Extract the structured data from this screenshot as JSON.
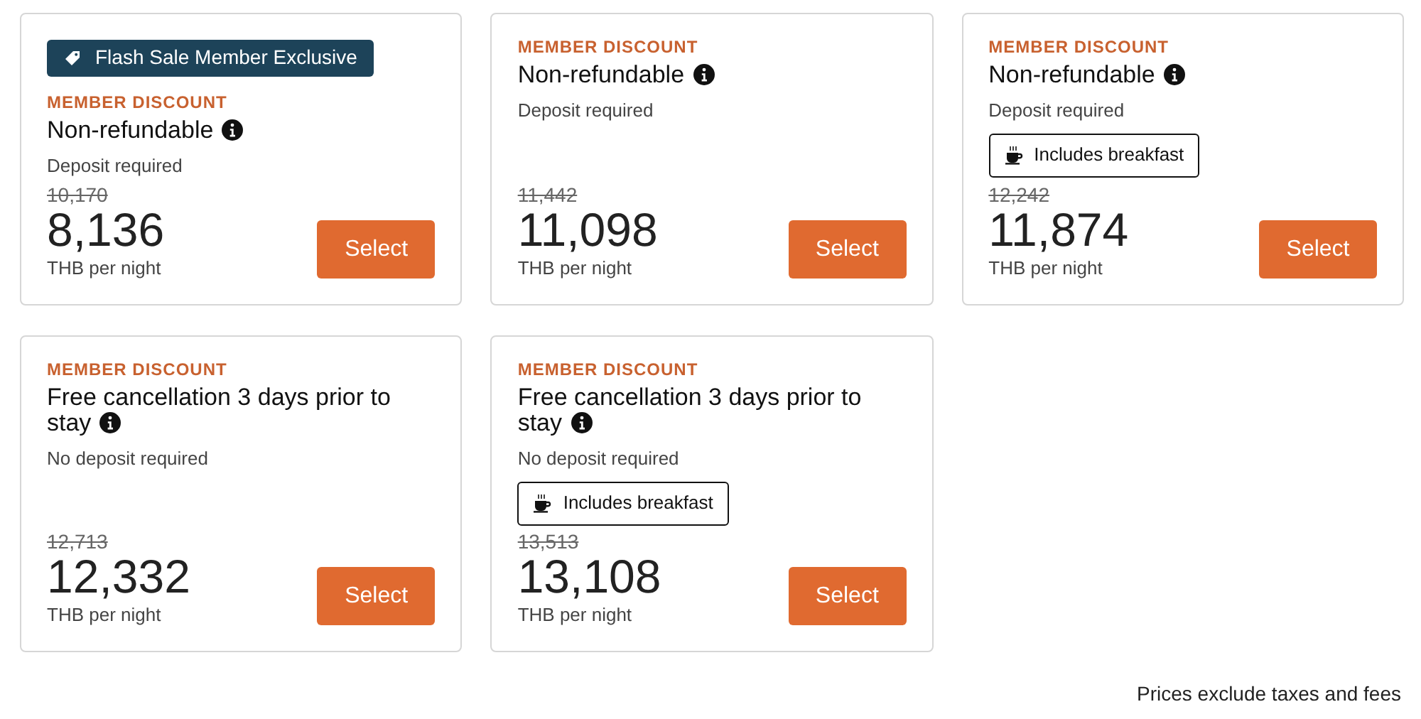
{
  "offers": [
    {
      "promo_badge": "Flash Sale Member Exclusive",
      "label": "MEMBER DISCOUNT",
      "title": "Non-refundable",
      "deposit": "Deposit required",
      "original_price": "10,170",
      "price": "8,136",
      "unit": "THB per night",
      "button": "Select"
    },
    {
      "label": "MEMBER DISCOUNT",
      "title": "Non-refundable",
      "deposit": "Deposit required",
      "original_price": "11,442",
      "price": "11,098",
      "unit": "THB per night",
      "button": "Select"
    },
    {
      "label": "MEMBER DISCOUNT",
      "title": "Non-refundable",
      "deposit": "Deposit required",
      "amenity": "Includes breakfast",
      "original_price": "12,242",
      "price": "11,874",
      "unit": "THB per night",
      "button": "Select"
    },
    {
      "label": "MEMBER DISCOUNT",
      "title": "Free cancellation 3 days prior to stay",
      "deposit": "No deposit required",
      "original_price": "12,713",
      "price": "12,332",
      "unit": "THB per night",
      "button": "Select"
    },
    {
      "label": "MEMBER DISCOUNT",
      "title": "Free cancellation 3 days prior to stay",
      "deposit": "No deposit required",
      "amenity": "Includes breakfast",
      "original_price": "13,513",
      "price": "13,108",
      "unit": "THB per night",
      "button": "Select"
    }
  ],
  "footnote": "Prices exclude taxes and fees"
}
